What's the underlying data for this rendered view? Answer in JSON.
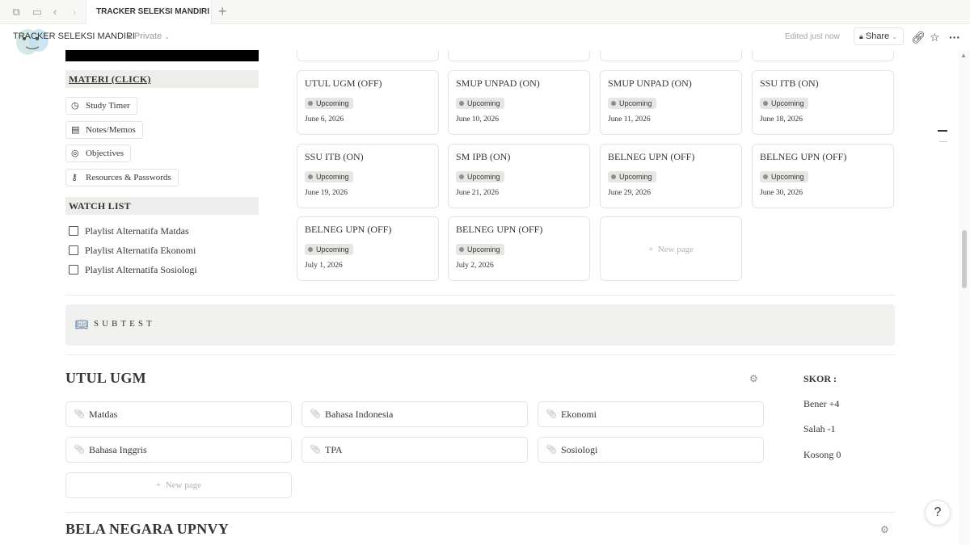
{
  "tabbar": {
    "tab_title": "TRACKER SELEKSI MANDIRI",
    "new_tab": "+"
  },
  "topbar": {
    "breadcrumb": "TRACKER SELEKSI MANDIRI",
    "privacy": "Private",
    "edited": "Edited just now",
    "share_label": "Share",
    "icons": [
      "link-icon",
      "star-icon",
      "more-icon"
    ]
  },
  "left": {
    "materi_heading": "MATERI (CLICK)",
    "materi_items": [
      {
        "icon": "clock-icon",
        "label": "Study Timer"
      },
      {
        "icon": "note-icon",
        "label": "Notes/Memos"
      },
      {
        "icon": "target-icon",
        "label": "Objectives"
      },
      {
        "icon": "key-icon",
        "label": "Resources & Passwords"
      }
    ],
    "watch_heading": "WATCH LIST",
    "watch_items": [
      {
        "label": "Playlist Alternatifa Matdas",
        "checked": false
      },
      {
        "label": "Playlist Alternatifa Ekonomi",
        "checked": false
      },
      {
        "label": "Playlist Alternatifa Sosiologi",
        "checked": false
      }
    ]
  },
  "board": {
    "cards": [
      {
        "title": "UTUL UGM (OFF)",
        "status": "Upcoming",
        "date": "June 6, 2026"
      },
      {
        "title": "SMUP UNPAD (ON)",
        "status": "Upcoming",
        "date": "June 10, 2026"
      },
      {
        "title": "SMUP UNPAD (ON)",
        "status": "Upcoming",
        "date": "June 11, 2026"
      },
      {
        "title": "SSU ITB (ON)",
        "status": "Upcoming",
        "date": "June 18, 2026"
      },
      {
        "title": "SSU ITB (ON)",
        "status": "Upcoming",
        "date": "June 19, 2026"
      },
      {
        "title": "SM IPB (ON)",
        "status": "Upcoming",
        "date": "June 21, 2026"
      },
      {
        "title": "BELNEG UPN (OFF)",
        "status": "Upcoming",
        "date": "June 29, 2026"
      },
      {
        "title": "BELNEG UPN (OFF)",
        "status": "Upcoming",
        "date": "June 30, 2026"
      },
      {
        "title": "BELNEG UPN (OFF)",
        "status": "Upcoming",
        "date": "July 1, 2026"
      },
      {
        "title": "BELNEG UPN (OFF)",
        "status": "Upcoming",
        "date": "July 2, 2026"
      }
    ],
    "new_page": "New page"
  },
  "subtest": {
    "icon": "book-icon",
    "label": "SUBTEST"
  },
  "utul": {
    "heading": "UTUL UGM",
    "items": [
      "Matdas",
      "Bahasa Indonesia",
      "Ekonomi",
      "Bahasa Inggris",
      "TPA",
      "Sosiologi"
    ],
    "new_page": "New page"
  },
  "skor": {
    "title": "SKOR :",
    "benar": "Bener +4",
    "salah": "Salah -1",
    "kosong": "Kosong 0"
  },
  "belneg": {
    "heading": "BELA NEGARA UPNVY"
  }
}
